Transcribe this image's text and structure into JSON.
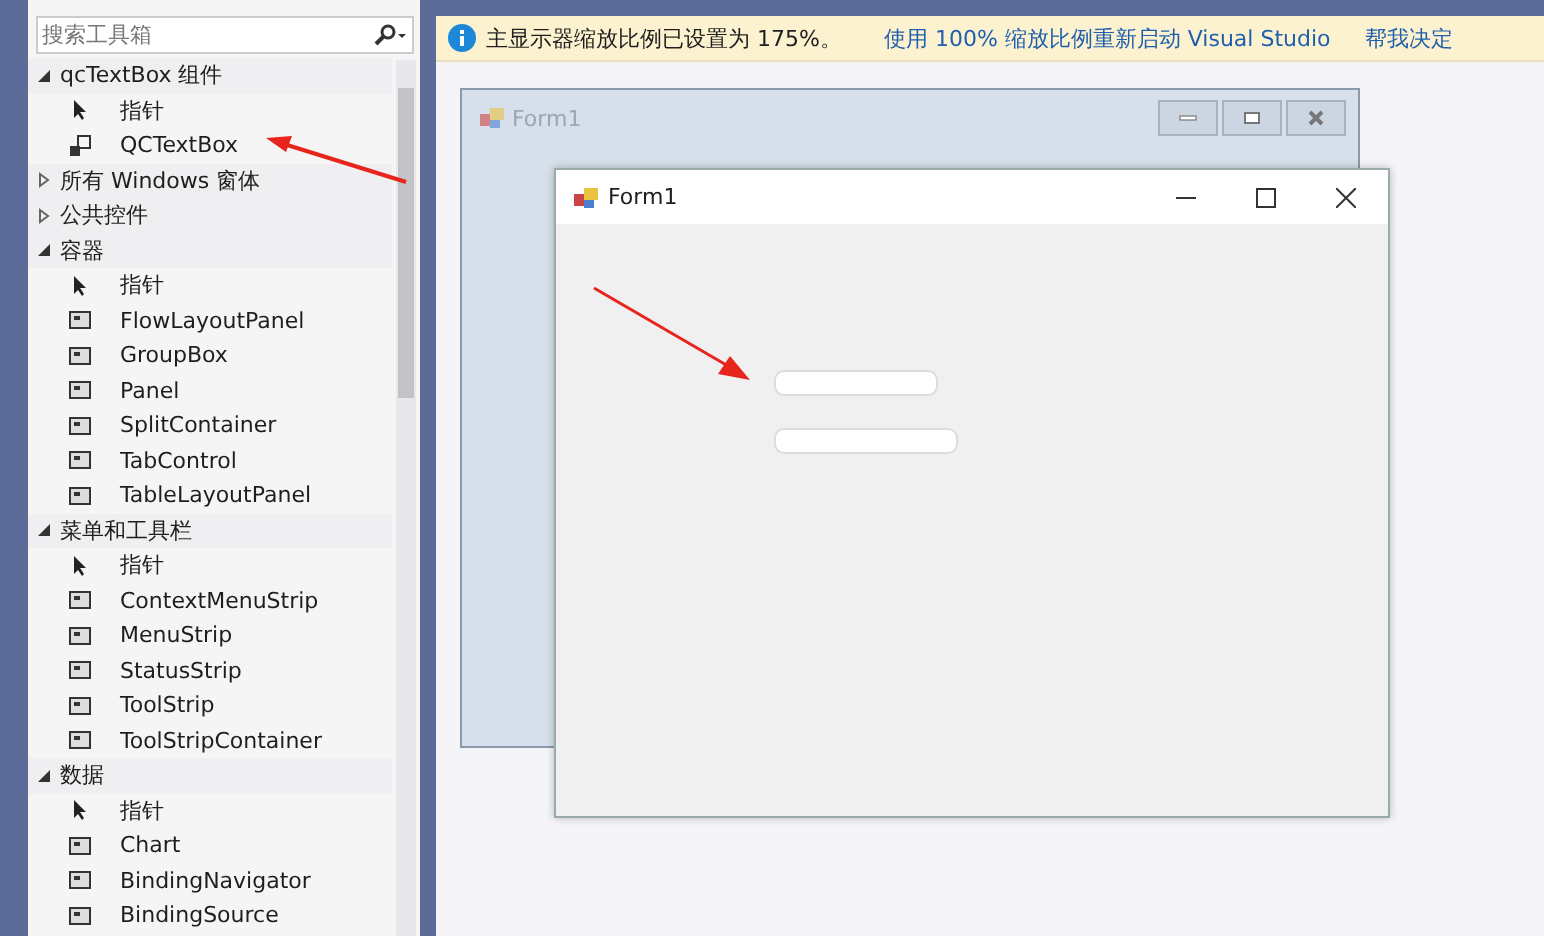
{
  "toolbox": {
    "search": {
      "placeholder": "搜索工具箱"
    },
    "groups": [
      {
        "label": "qcTextBox 组件",
        "expanded": true,
        "children": [
          {
            "label": "指针",
            "kind": "pointer"
          },
          {
            "label": "QCTextBox",
            "kind": "component"
          }
        ]
      },
      {
        "label": "所有 Windows 窗体",
        "expanded": false
      },
      {
        "label": "公共控件",
        "expanded": false
      },
      {
        "label": "容器",
        "expanded": true,
        "children": [
          {
            "label": "指针",
            "kind": "pointer"
          },
          {
            "label": "FlowLayoutPanel",
            "kind": "control"
          },
          {
            "label": "GroupBox",
            "kind": "control"
          },
          {
            "label": "Panel",
            "kind": "control"
          },
          {
            "label": "SplitContainer",
            "kind": "control"
          },
          {
            "label": "TabControl",
            "kind": "control"
          },
          {
            "label": "TableLayoutPanel",
            "kind": "control"
          }
        ]
      },
      {
        "label": "菜单和工具栏",
        "expanded": true,
        "children": [
          {
            "label": "指针",
            "kind": "pointer"
          },
          {
            "label": "ContextMenuStrip",
            "kind": "control"
          },
          {
            "label": "MenuStrip",
            "kind": "control"
          },
          {
            "label": "StatusStrip",
            "kind": "control"
          },
          {
            "label": "ToolStrip",
            "kind": "control"
          },
          {
            "label": "ToolStripContainer",
            "kind": "control"
          }
        ]
      },
      {
        "label": "数据",
        "expanded": true,
        "children": [
          {
            "label": "指针",
            "kind": "pointer"
          },
          {
            "label": "Chart",
            "kind": "control"
          },
          {
            "label": "BindingNavigator",
            "kind": "control"
          },
          {
            "label": "BindingSource",
            "kind": "control"
          }
        ]
      }
    ]
  },
  "info_bar": {
    "message": "主显示器缩放比例已设置为 175%。",
    "links": [
      "使用 100% 缩放比例重新启动 Visual Studio",
      "帮我决定"
    ]
  },
  "designer": {
    "back_form": {
      "title": "Form1"
    },
    "front_form": {
      "title": "Form1",
      "textboxes": [
        {
          "kind": "text-box"
        },
        {
          "kind": "text-box"
        }
      ]
    }
  }
}
